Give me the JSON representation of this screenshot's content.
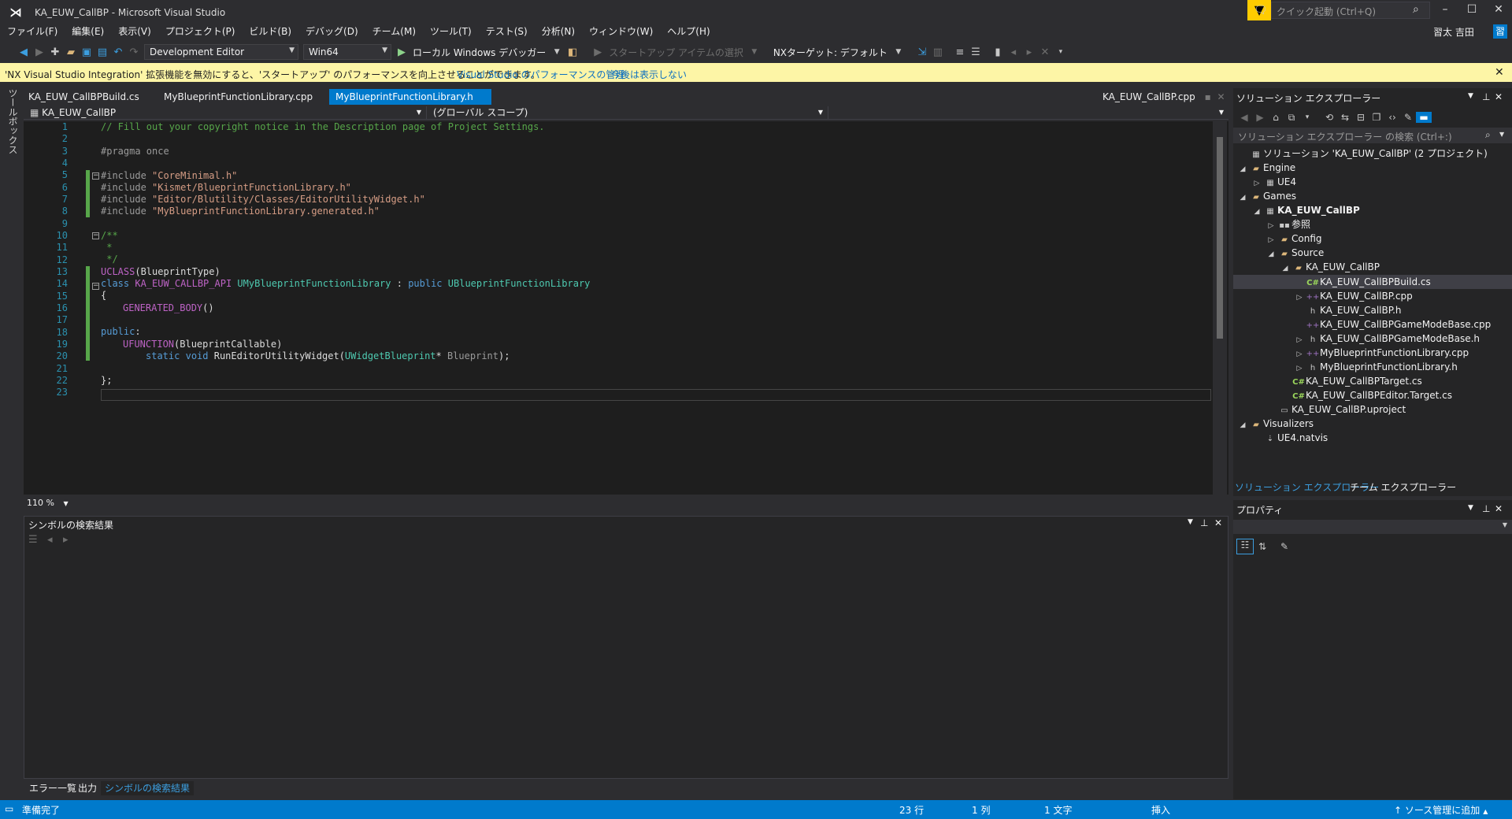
{
  "window": {
    "title": "KA_EUW_CallBP - Microsoft Visual Studio",
    "quick_launch_placeholder": "クイック起動 (Ctrl+Q)",
    "user": "習太 吉田",
    "user_initial": "習"
  },
  "menu": [
    "ファイル(F)",
    "編集(E)",
    "表示(V)",
    "プロジェクト(P)",
    "ビルド(B)",
    "デバッグ(D)",
    "チーム(M)",
    "ツール(T)",
    "テスト(S)",
    "分析(N)",
    "ウィンドウ(W)",
    "ヘルプ(H)"
  ],
  "toolbar": {
    "configuration": "Development Editor",
    "platform": "Win64",
    "run_label": "ローカル Windows デバッガー",
    "startup_item": "スタートアップ アイテムの選択",
    "nx_target": "NXターゲット: デフォルト"
  },
  "infobar": {
    "message": "'NX Visual Studio Integration' 拡張機能を無効にすると、'スタートアップ' のパフォーマンスを向上させることができます。",
    "link_manage": "Visual Studio のパフォーマンスの管理",
    "link_dismiss": "今後は表示しない"
  },
  "toolbox_label": "ツールボックス",
  "tabs": [
    {
      "label": "KA_EUW_CallBPBuild.cs"
    },
    {
      "label": "MyBlueprintFunctionLibrary.cpp"
    },
    {
      "label": "MyBlueprintFunctionLibrary.h"
    }
  ],
  "tab_right": "KA_EUW_CallBP.cpp",
  "navbar": {
    "project": "KA_EUW_CallBP",
    "scope": "(グローバル スコープ)"
  },
  "code": {
    "line_numbers": [
      "1",
      "2",
      "3",
      "4",
      "5",
      "6",
      "7",
      "8",
      "9",
      "10",
      "11",
      "12",
      "13",
      "14",
      "15",
      "16",
      "17",
      "18",
      "19",
      "20",
      "21",
      "22",
      "23"
    ],
    "l1": "// Fill out your copyright notice in the Description page of Project Settings.",
    "l3_pre": "#pragma",
    "l3_rest": " once",
    "inc": "#include",
    "l5_str": "\"CoreMinimal.h\"",
    "l6_str": "\"Kismet/BlueprintFunctionLibrary.h\"",
    "l7_str": "\"Editor/Blutility/Classes/EditorUtilityWidget.h\"",
    "l8_str": "\"MyBlueprintFunctionLibrary.generated.h\"",
    "l10": "/**",
    "l11": " *",
    "l12": " */",
    "l13_macro": "UCLASS",
    "l13_rest": "(BlueprintType)",
    "l14_kw": "class",
    "l14_api": "KA_EUW_CALLBP_API",
    "l14_cls": "UMyBlueprintFunctionLibrary",
    "l14_colon": " : ",
    "l14_pub": "public",
    "l14_base": "UBlueprintFunctionLibrary",
    "l15": "{",
    "l16_macro": "GENERATED_BODY",
    "l16_rest": "()",
    "l18_kw": "public",
    "l18_rest": ":",
    "l19_macro": "UFUNCTION",
    "l19_rest": "(BlueprintCallable)",
    "l20_static": "static",
    "l20_void": "void",
    "l20_fn": "RunEditorUtilityWidget",
    "l20_open": "(",
    "l20_type": "UWidgetBlueprint",
    "l20_star": "* ",
    "l20_param": "Blueprint",
    "l20_close": ");",
    "l22": "};"
  },
  "zoom": "110 %",
  "symbol_panel": {
    "title": "シンボルの検索結果"
  },
  "bottom_tabs": [
    "エラー一覧",
    "出力",
    "シンボルの検索結果"
  ],
  "solution_explorer": {
    "title": "ソリューション エクスプローラー",
    "search_placeholder": "ソリューション エクスプローラー の検索 (Ctrl+:)",
    "tree": [
      {
        "label": "ソリューション 'KA_EUW_CallBP' (2 プロジェクト)",
        "icon": "solution-icon"
      },
      {
        "label": "Engine",
        "icon": "folder-icon"
      },
      {
        "label": "UE4",
        "icon": "project-icon"
      },
      {
        "label": "Games",
        "icon": "folder-icon"
      },
      {
        "label": "KA_EUW_CallBP",
        "icon": "project-icon"
      },
      {
        "label": "参照",
        "icon": "references-icon"
      },
      {
        "label": "Config",
        "icon": "folder-icon"
      },
      {
        "label": "Source",
        "icon": "folder-icon"
      },
      {
        "label": "KA_EUW_CallBP",
        "icon": "folder-icon"
      },
      {
        "label": "KA_EUW_CallBPBuild.cs",
        "icon": "csharp-icon"
      },
      {
        "label": "KA_EUW_CallBP.cpp",
        "icon": "cpp-icon"
      },
      {
        "label": "KA_EUW_CallBP.h",
        "icon": "header-icon"
      },
      {
        "label": "KA_EUW_CallBPGameModeBase.cpp",
        "icon": "cpp-icon"
      },
      {
        "label": "KA_EUW_CallBPGameModeBase.h",
        "icon": "header-icon"
      },
      {
        "label": "MyBlueprintFunctionLibrary.cpp",
        "icon": "cpp-icon"
      },
      {
        "label": "MyBlueprintFunctionLibrary.h",
        "icon": "header-icon"
      },
      {
        "label": "KA_EUW_CallBPTarget.cs",
        "icon": "csharp-icon"
      },
      {
        "label": "KA_EUW_CallBPEditor.Target.cs",
        "icon": "csharp-icon"
      },
      {
        "label": "KA_EUW_CallBP.uproject",
        "icon": "file-icon"
      },
      {
        "label": "Visualizers",
        "icon": "folder-icon"
      },
      {
        "label": "UE4.natvis",
        "icon": "natvis-icon"
      }
    ],
    "tab_solution": "ソリューション エクスプローラー",
    "tab_team": "チーム エクスプローラー"
  },
  "properties": {
    "title": "プロパティ"
  },
  "status": {
    "ready": "準備完了",
    "line": "23 行",
    "col": "1 列",
    "ch": "1 文字",
    "mode": "挿入",
    "source_control": "ソース管理に追加"
  }
}
